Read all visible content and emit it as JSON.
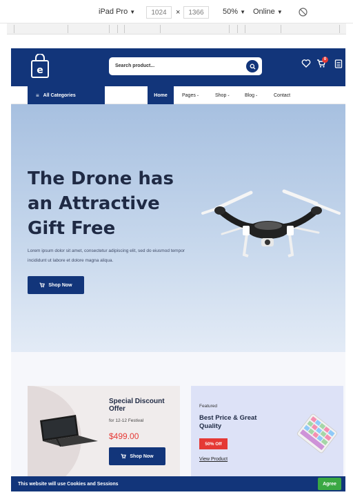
{
  "devtools": {
    "device": "iPad Pro",
    "width": "1024",
    "times": "×",
    "height": "1366",
    "zoom": "50%",
    "network": "Online",
    "caret": "▼"
  },
  "header": {
    "search_placeholder": "Search product...",
    "cart_count": "0"
  },
  "nav": {
    "all_categories": "All Categories",
    "home": "Home",
    "pages": "Pages",
    "shop": "Shop",
    "blog": "Blog",
    "contact": "Contact"
  },
  "hero": {
    "title": "The Drone has an Attractive Gift Free",
    "text": "Lorem ipsum dolor sit amet, consectetur adipiscing elit, sed do eiusmod tempor incididunt ut labore et dolore magna aliqua.",
    "button": "Shop Now"
  },
  "promo1": {
    "title": "Special Discount Offer",
    "subtitle": "for 12-12 Festival",
    "price": "$499.00",
    "button": "Shop Now"
  },
  "promo2": {
    "tag": "Featured",
    "title": "Best Price & Great Quality",
    "badge": "50% Off",
    "link": "View Product"
  },
  "cookie": {
    "text": "This website will use Cookies and Sessions",
    "button": "Agree"
  },
  "colors": {
    "primary": "#12357a",
    "sale": "#e53935",
    "agree": "#3aa843"
  }
}
